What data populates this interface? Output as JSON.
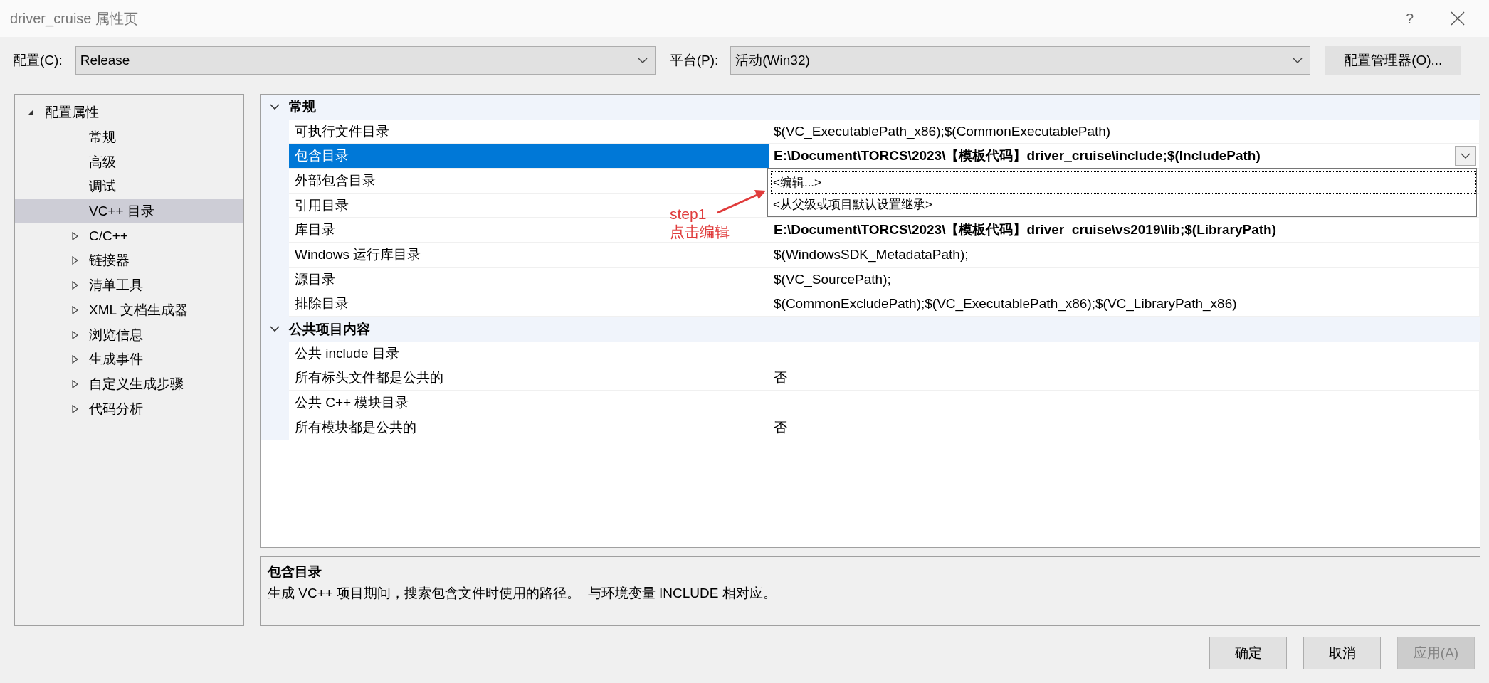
{
  "window": {
    "title": "driver_cruise 属性页",
    "help": "?"
  },
  "toolbar": {
    "config_label": "配置(C):",
    "config_value": "Release",
    "platform_label": "平台(P):",
    "platform_value": "活动(Win32)",
    "manager_button": "配置管理器(O)..."
  },
  "tree": [
    {
      "label": "配置属性",
      "kind": "group",
      "expanded": true,
      "selected": false,
      "children": [
        {
          "label": "常规",
          "kind": "leaf",
          "selected": false
        },
        {
          "label": "高级",
          "kind": "leaf",
          "selected": false
        },
        {
          "label": "调试",
          "kind": "leaf",
          "selected": false
        },
        {
          "label": "VC++ 目录",
          "kind": "leaf",
          "selected": true
        },
        {
          "label": "C/C++",
          "kind": "group",
          "expanded": false,
          "selected": false
        },
        {
          "label": "链接器",
          "kind": "group",
          "expanded": false,
          "selected": false
        },
        {
          "label": "清单工具",
          "kind": "group",
          "expanded": false,
          "selected": false
        },
        {
          "label": "XML 文档生成器",
          "kind": "group",
          "expanded": false,
          "selected": false
        },
        {
          "label": "浏览信息",
          "kind": "group",
          "expanded": false,
          "selected": false
        },
        {
          "label": "生成事件",
          "kind": "group",
          "expanded": false,
          "selected": false
        },
        {
          "label": "自定义生成步骤",
          "kind": "group",
          "expanded": false,
          "selected": false
        },
        {
          "label": "代码分析",
          "kind": "group",
          "expanded": false,
          "selected": false
        }
      ]
    }
  ],
  "grid": {
    "sections": [
      {
        "title": "常规",
        "expanded": true,
        "rows": [
          {
            "name": "可执行文件目录",
            "value": "$(VC_ExecutablePath_x86);$(CommonExecutablePath)",
            "bold": false,
            "selected": false
          },
          {
            "name": "包含目录",
            "value": "E:\\Document\\TORCS\\2023\\【模板代码】driver_cruise\\include;$(IncludePath)",
            "bold": true,
            "selected": true
          },
          {
            "name": "外部包含目录",
            "selected": false
          },
          {
            "name": "引用目录",
            "selected": false
          },
          {
            "name": "库目录",
            "value": "E:\\Document\\TORCS\\2023\\【模板代码】driver_cruise\\vs2019\\lib;$(LibraryPath)",
            "bold": true,
            "selected": false
          },
          {
            "name": "Windows 运行库目录",
            "value": "$(WindowsSDK_MetadataPath);",
            "bold": false,
            "selected": false
          },
          {
            "name": "源目录",
            "value": "$(VC_SourcePath);",
            "bold": false,
            "selected": false
          },
          {
            "name": "排除目录",
            "value": "$(CommonExcludePath);$(VC_ExecutablePath_x86);$(VC_LibraryPath_x86)",
            "bold": false,
            "selected": false
          }
        ]
      },
      {
        "title": "公共项目内容",
        "expanded": true,
        "rows": [
          {
            "name": "公共 include 目录",
            "selected": false
          },
          {
            "name": "所有标头文件都是公共的",
            "value": "否",
            "bold": false,
            "selected": false
          },
          {
            "name": "公共 C++ 模块目录",
            "selected": false
          },
          {
            "name": "所有模块都是公共的",
            "value": "否",
            "bold": false,
            "selected": false
          }
        ]
      }
    ],
    "popup": [
      {
        "label": "<编辑...>",
        "selected": true
      },
      {
        "label": "<从父级或项目默认设置继承>",
        "selected": false
      }
    ],
    "annotation": [
      "step1",
      "点击编辑"
    ]
  },
  "description": {
    "title": "包含目录",
    "text": "生成 VC++ 项目期间，搜索包含文件时使用的路径。  与环境变量 INCLUDE 相对应。"
  },
  "buttons": [
    {
      "label": "确定",
      "disabled": false
    },
    {
      "label": "取消",
      "disabled": false
    },
    {
      "label": "应用(A)",
      "disabled": true
    }
  ]
}
